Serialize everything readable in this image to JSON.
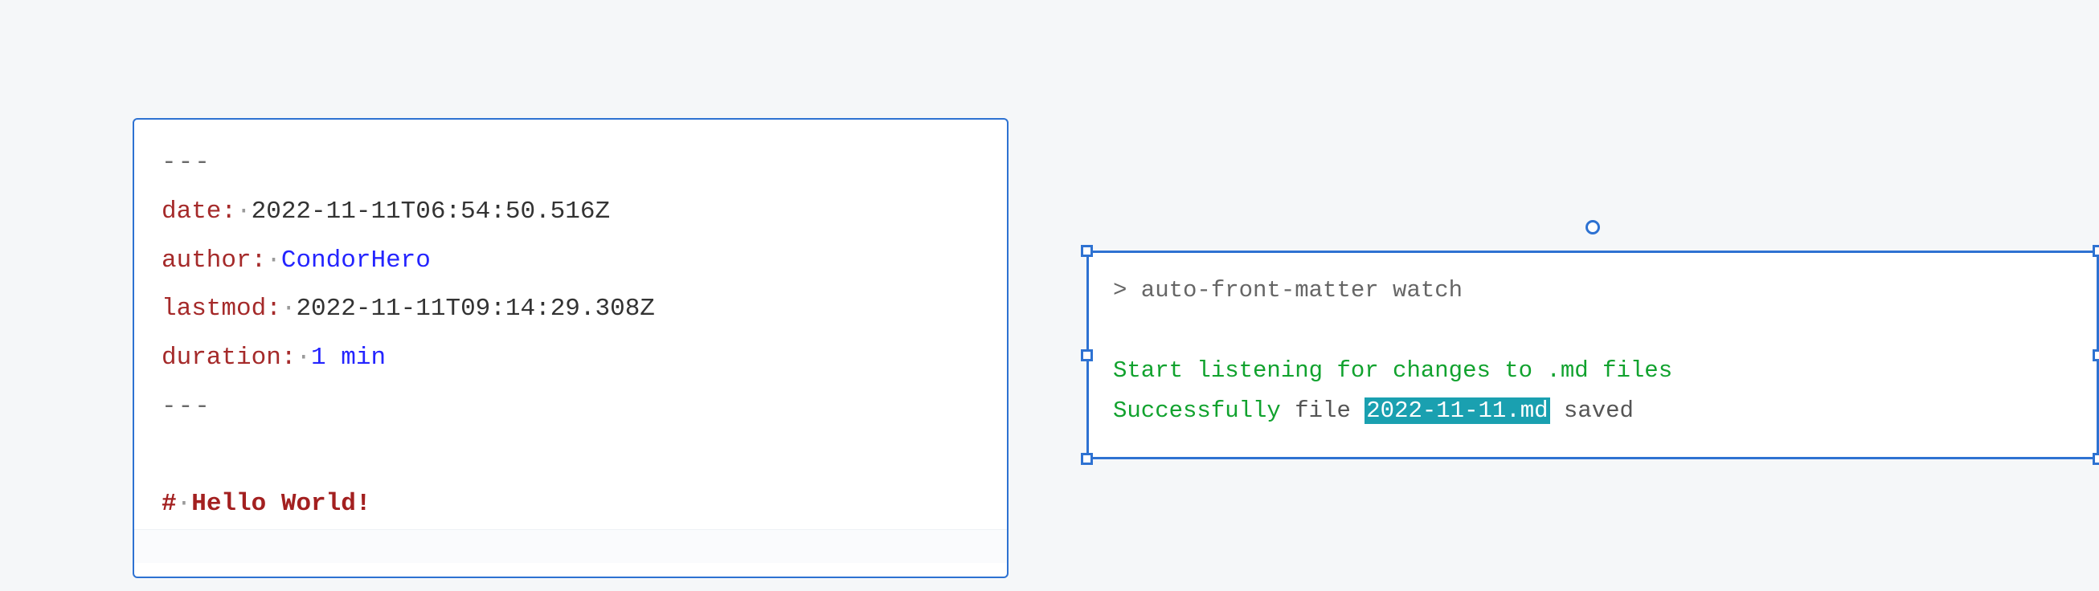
{
  "editor": {
    "fm_open": "---",
    "date_key": "date:",
    "date_value": "2022-11-11T06:54:50.516Z",
    "author_key": "author:",
    "author_value": "CondorHero",
    "lastmod_key": "lastmod:",
    "lastmod_value": "2022-11-11T09:14:29.308Z",
    "duration_key": "duration:",
    "duration_value": "1 min",
    "fm_close": "---",
    "heading_marker": "#",
    "heading_text": "Hello World!",
    "dot": "·"
  },
  "terminal": {
    "prompt": "> auto-front-matter watch",
    "listen": "Start listening for changes to .md files",
    "success_pre": "Successfully",
    "file_word": " file ",
    "filename": "2022-11-11.md",
    "saved": " saved"
  }
}
